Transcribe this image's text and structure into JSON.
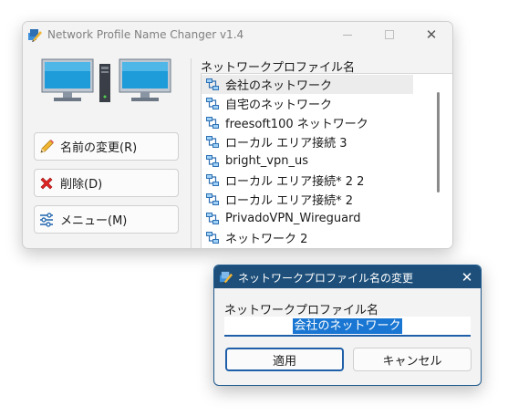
{
  "main_window": {
    "title": "Network Profile Name Changer v1.4",
    "close_glyph": "✕",
    "buttons": {
      "rename": "名前の変更(R)",
      "delete": "削除(D)",
      "menu": "メニュー(M)"
    },
    "list_label": "ネットワークプロファイル名",
    "profiles": [
      "会社のネットワーク",
      "自宅のネットワーク",
      "freesoft100 ネットワーク",
      "ローカル エリア接続 3",
      "bright_vpn_us",
      "ローカル エリア接続* 2 2",
      "ローカル エリア接続* 2",
      "PrivadoVPN_Wireguard",
      "ネットワーク 2"
    ],
    "selected_index": 0
  },
  "dialog": {
    "title": "ネットワークプロファイル名の変更",
    "close_glyph": "✕",
    "field_label": "ネットワークプロファイル名",
    "field_value": "会社のネットワーク",
    "ok_label": "適用",
    "cancel_label": "キャンセル"
  },
  "colors": {
    "dialog_titlebar": "#1d4f7a",
    "selection": "#1976d2",
    "accent": "#1f5fa8"
  },
  "icons": {
    "app": "pencil-network-icon",
    "rename": "pencil-icon",
    "delete": "red-x-icon",
    "menu": "sliders-icon",
    "profile": "network-icon",
    "computers": "two-computers-icon"
  }
}
